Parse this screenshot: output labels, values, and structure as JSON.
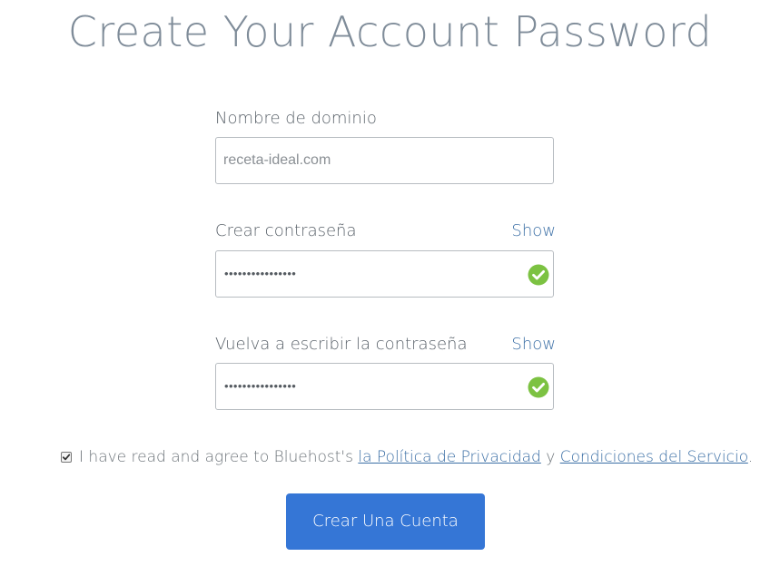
{
  "page": {
    "title": "Create Your Account Password"
  },
  "domain_field": {
    "label": "Nombre de dominio",
    "value": "receta-ideal.com"
  },
  "password_field": {
    "label": "Crear contraseña",
    "show_label": "Show",
    "masked_value": "••••••••••••••••",
    "valid": true
  },
  "confirm_field": {
    "label": "Vuelva a escribir la contraseña",
    "show_label": "Show",
    "masked_value": "••••••••••••••••",
    "valid": true
  },
  "agreement": {
    "checked": true,
    "prefix": "I have read and agree to Bluehost's ",
    "privacy_link": "la Política de Privacidad",
    "conjunction": " y ",
    "terms_link": "Condiciones del Servicio",
    "suffix": "."
  },
  "submit": {
    "label": "Crear Una Cuenta"
  },
  "colors": {
    "accent": "#3576d6",
    "link": "#3a6ea5",
    "valid": "#7cc242",
    "title": "#7f8c99"
  },
  "icons": {
    "valid": "check-circle-icon",
    "checkbox": "checkmark-icon"
  }
}
